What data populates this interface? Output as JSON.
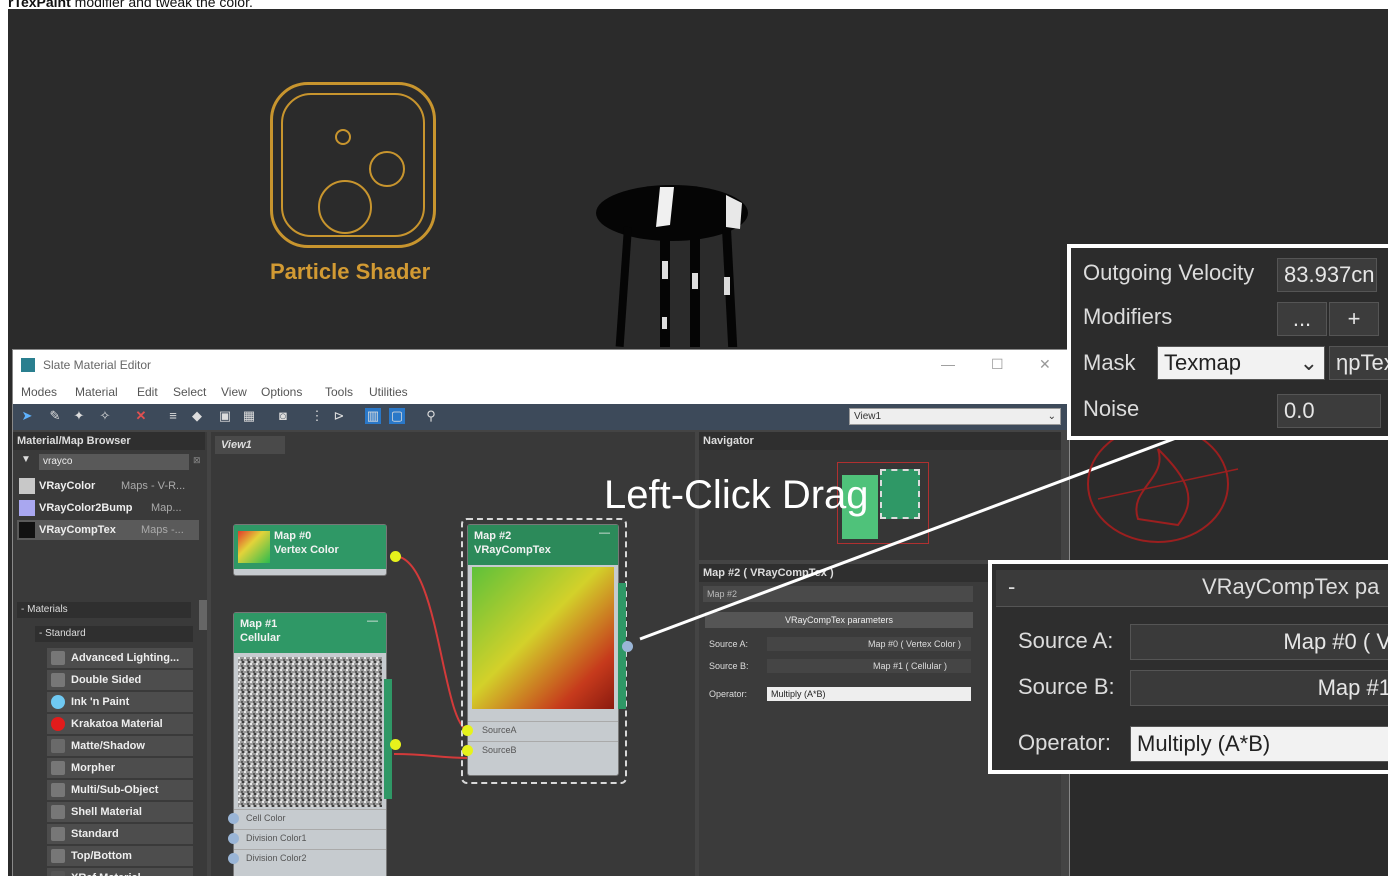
{
  "caption": {
    "bold": "rTexPaint",
    "rest": " modifier and tweak the color."
  },
  "particle_shader": {
    "label": "Particle Shader"
  },
  "window": {
    "title": "Slate Material Editor",
    "controls": [
      "—",
      "☐",
      "✕"
    ],
    "menus": [
      "Modes",
      "Material",
      "Edit",
      "Select",
      "View",
      "Options",
      "Tools",
      "Utilities"
    ],
    "view_select": "View1"
  },
  "browser": {
    "header": "Material/Map Browser",
    "search_value": "vrayco",
    "results": [
      {
        "name": "VRayColor",
        "category": "Maps - V-R...",
        "swatch": "#c8c8c8"
      },
      {
        "name": "VRayColor2Bump",
        "category": "Map...",
        "swatch": "#a9a7f0"
      },
      {
        "name": "VRayCompTex",
        "category": "Maps -...",
        "swatch": "#111111"
      }
    ],
    "materials_header": "- Materials",
    "standard_header": "- Standard",
    "materials": [
      {
        "label": "Advanced Lighting...",
        "color": "#777777"
      },
      {
        "label": "Double Sided",
        "color": "#777777"
      },
      {
        "label": "Ink 'n Paint",
        "color": "#6fc9f2"
      },
      {
        "label": "Krakatoa Material",
        "color": "#e21b1b"
      },
      {
        "label": "Matte/Shadow",
        "color": "#6a6a6a"
      },
      {
        "label": "Morpher",
        "color": "#777777"
      },
      {
        "label": "Multi/Sub-Object",
        "color": "#777777"
      },
      {
        "label": "Shell Material",
        "color": "#777777"
      },
      {
        "label": "Standard",
        "color": "#777777"
      },
      {
        "label": "Top/Bottom",
        "color": "#777777"
      },
      {
        "label": "XRef Material",
        "color": "#555555"
      }
    ]
  },
  "view": {
    "tab": "View1",
    "node0": {
      "title": "Map #0",
      "subtitle": "Vertex Color"
    },
    "node1": {
      "title": "Map #1",
      "subtitle": "Cellular",
      "ports": [
        "Cell Color",
        "Division Color1",
        "Division Color2"
      ]
    },
    "node2": {
      "title": "Map #2",
      "subtitle": "VRayCompTex",
      "ports": [
        "SourceA",
        "SourceB"
      ]
    }
  },
  "navigator": {
    "header": "Navigator"
  },
  "params": {
    "header": "Map #2  ( VRayCompTex )",
    "name_field": "Map #2",
    "rollout": "VRayCompTex parameters",
    "source_a_label": "Source A:",
    "source_a_value": "Map #0  ( Vertex Color )",
    "source_b_label": "Source B:",
    "source_b_value": "Map #1  ( Cellular )",
    "operator_label": "Operator:",
    "operator_value": "Multiply (A*B)"
  },
  "annotation": "Left-Click Drag",
  "zoom1": {
    "outgoing_velocity_label": "Outgoing Velocity",
    "outgoing_velocity_value": "83.937cn",
    "modifiers_label": "Modifiers",
    "modifiers_btn": "...",
    "add_btn": "+",
    "mask_label": "Mask",
    "mask_value": "Texmap",
    "mask_tex": "ηpTex",
    "noise_label": "Noise",
    "noise_value": "0.0"
  },
  "zoom2": {
    "title": "VRayCompTex pa",
    "collapse": "-",
    "source_a_label": "Source A:",
    "source_a_value": "Map #0  ( V",
    "source_b_label": "Source B:",
    "source_b_value": "Map #1",
    "operator_label": "Operator:",
    "operator_value": "Multiply (A*B)"
  }
}
